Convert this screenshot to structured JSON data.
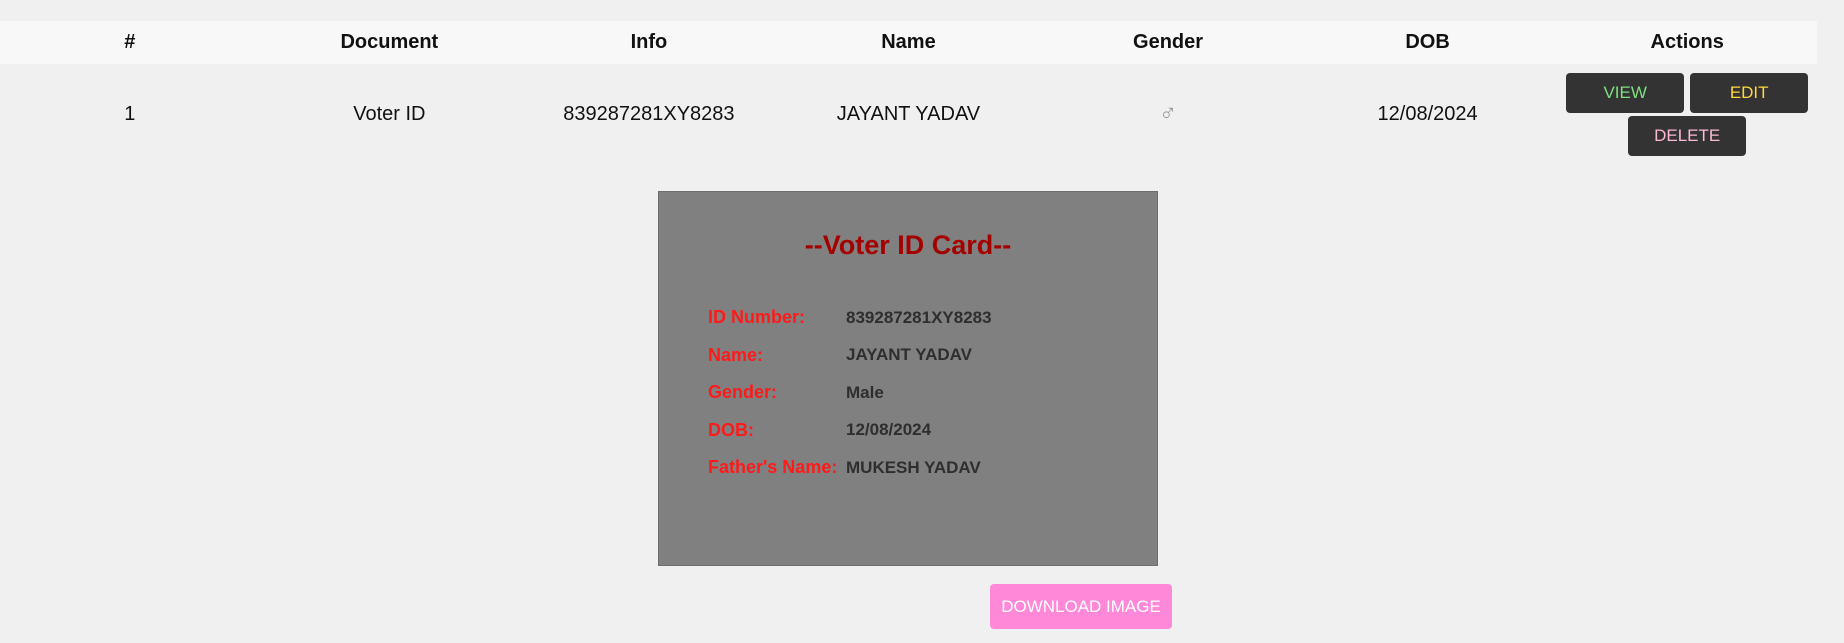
{
  "table": {
    "headers": [
      "#",
      "Document",
      "Info",
      "Name",
      "Gender",
      "DOB",
      "Actions"
    ],
    "rows": [
      {
        "index": "1",
        "document": "Voter ID",
        "info": "839287281XY8283",
        "name": "JAYANT YADAV",
        "gender_symbol": "♂",
        "dob": "12/08/2024",
        "actions": {
          "view": "VIEW",
          "edit": "EDIT",
          "delete": "DELETE"
        }
      }
    ]
  },
  "card": {
    "title": "--Voter ID Card--",
    "fields": [
      {
        "label": "ID Number:",
        "value": "839287281XY8283"
      },
      {
        "label": "Name:",
        "value": "JAYANT YADAV"
      },
      {
        "label": "Gender:",
        "value": "Male"
      },
      {
        "label": "DOB:",
        "value": "12/08/2024"
      },
      {
        "label": "Father's Name:",
        "value": "MUKESH YADAV"
      }
    ]
  },
  "download_button": "DOWNLOAD IMAGE",
  "colors": {
    "view_text": "#7ee07e",
    "edit_text": "#ffd93b",
    "delete_text": "#ffb8d6",
    "card_background": "#808080",
    "card_title": "#a50000",
    "card_label": "#ff1a1a",
    "download_button": "#ff88d8"
  }
}
